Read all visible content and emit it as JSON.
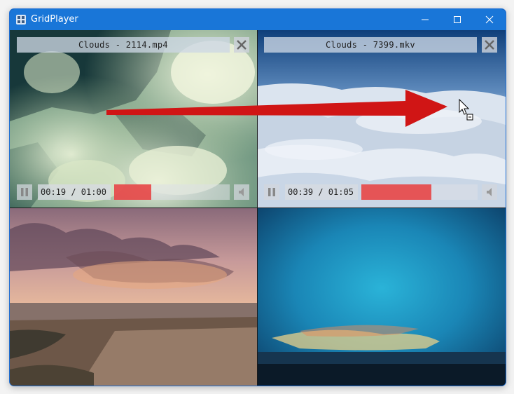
{
  "window": {
    "title": "GridPlayer",
    "icons": {
      "app": "grid-app-icon",
      "minimize": "minimize-icon",
      "maximize": "maximize-icon",
      "close": "close-icon"
    }
  },
  "players": [
    {
      "filename": "Clouds - 2114.mp4",
      "time": "00:19 / 01:00",
      "progress_percent": 32,
      "controls_visible": true
    },
    {
      "filename": "Clouds - 7399.mkv",
      "time": "00:39 / 01:05",
      "progress_percent": 60,
      "controls_visible": true
    },
    {
      "filename": "",
      "controls_visible": false
    },
    {
      "filename": "",
      "controls_visible": false
    }
  ],
  "icons": {
    "pause": "pause-icon",
    "close_player": "close-x-icon",
    "volume": "volume-icon",
    "drag_cursor": "drag-cursor-icon",
    "arrow": "red-arrow-annotation"
  },
  "colors": {
    "titlebar": "#1976d8",
    "seek_fill": "#e83c3c",
    "arrow": "#d01515"
  }
}
